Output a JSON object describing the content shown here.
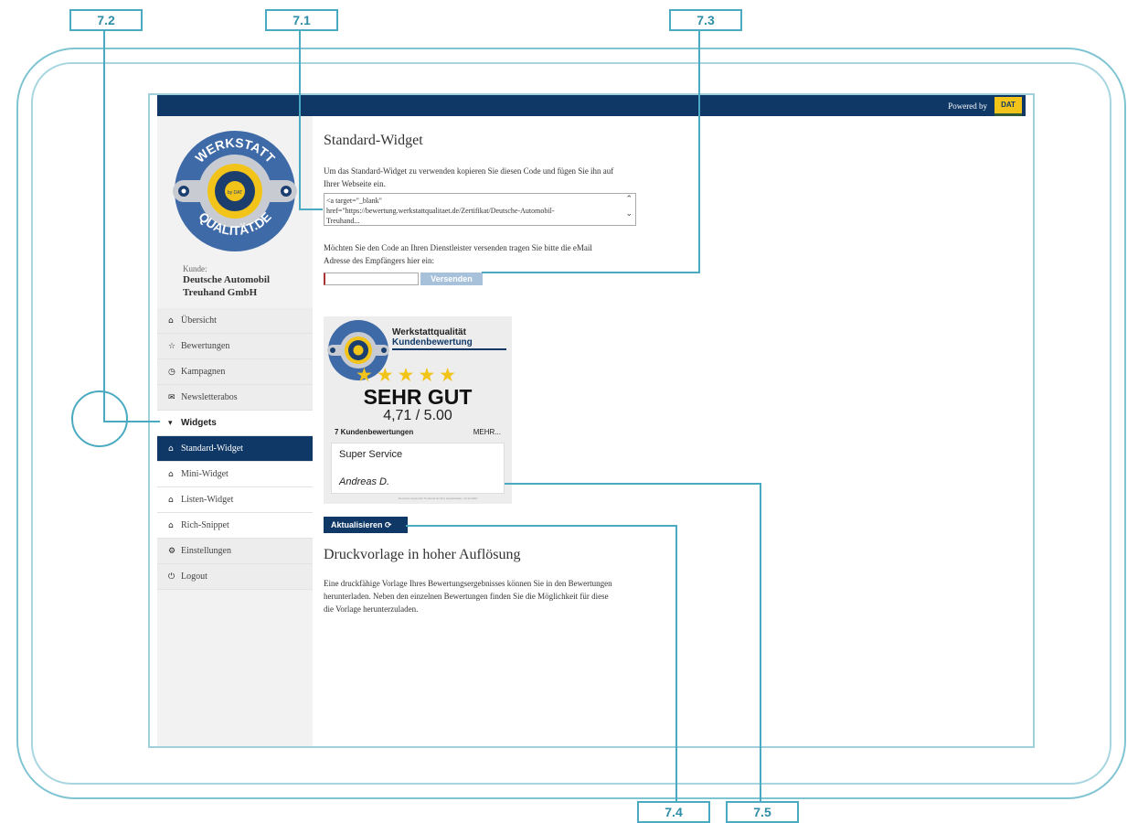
{
  "callouts": {
    "c71": "7.1",
    "c72": "7.2",
    "c73": "7.3",
    "c74": "7.4",
    "c75": "7.5"
  },
  "header": {
    "powered_by": "Powered by",
    "dat_logo": "DAT"
  },
  "sidebar": {
    "logo": {
      "top": "WERKSTATT",
      "bottom": "QUALITÄT.DE",
      "center": "by DAT"
    },
    "kunde_label": "Kunde:",
    "kunde_name_1": "Deutsche Automobil",
    "kunde_name_2": "Treuhand GmbH",
    "menu": [
      {
        "label": "Übersicht",
        "icon": "home-icon"
      },
      {
        "label": "Bewertungen",
        "icon": "star-outline-icon"
      },
      {
        "label": "Kampagnen",
        "icon": "clock-icon"
      },
      {
        "label": "Newsletterabos",
        "icon": "envelope-icon"
      },
      {
        "label": "Widgets",
        "icon": "caret-down-icon"
      },
      {
        "label": "Standard-Widget",
        "icon": "home-icon"
      },
      {
        "label": "Mini-Widget",
        "icon": "home-icon"
      },
      {
        "label": "Listen-Widget",
        "icon": "home-icon"
      },
      {
        "label": "Rich-Snippet",
        "icon": "home-icon"
      },
      {
        "label": "Einstellungen",
        "icon": "gear-icon"
      },
      {
        "label": "Logout",
        "icon": "power-icon"
      }
    ]
  },
  "main": {
    "title": "Standard-Widget",
    "intro_1": "Um das Standard-Widget zu verwenden kopieren Sie diesen Code und fügen Sie ihn auf",
    "intro_2": "Ihrer Webseite ein.",
    "code_1": "<a target=\"_blank\"",
    "code_2": "href=\"https://bewertung.werkstattqualitaet.de/Zertifikat/Deutsche-Automobil-",
    "code_3": "Treuhand...",
    "send_text_1": "Möchten Sie den Code an Ihren Dienstleister versenden tragen Sie bitte die eMail",
    "send_text_2": "Adresse des Empfängers hier ein:",
    "email_value": "",
    "send_button": "Versenden",
    "widget": {
      "title_1": "Werkstattqualität",
      "title_2": "Kundenbewertung",
      "stars": "★★★★★",
      "verdict": "SEHR GUT",
      "score": "4,71 / 5.00",
      "count": "7 Kundenbewertungen",
      "more": "MEHR...",
      "review_text": "Super Service",
      "review_author": "Andreas D.",
      "footer": "Deutsche Automobil Treuhand GmbH | Hauptstraße | 10.12.2016"
    },
    "refresh_button": "Aktualisieren",
    "print_title": "Druckvorlage in hoher Auflösung",
    "print_1": "Eine druckfähige Vorlage Ihres Bewertungsergebnisses können Sie in den Bewertungen",
    "print_2": "herunterladen. Neben den einzelnen Bewertungen finden Sie die Möglichkeit für diese",
    "print_3": "die Vorlage herunterzuladen."
  },
  "colors": {
    "navy": "#0f3867",
    "callout": "#49aac1",
    "star": "#f2c41a"
  }
}
